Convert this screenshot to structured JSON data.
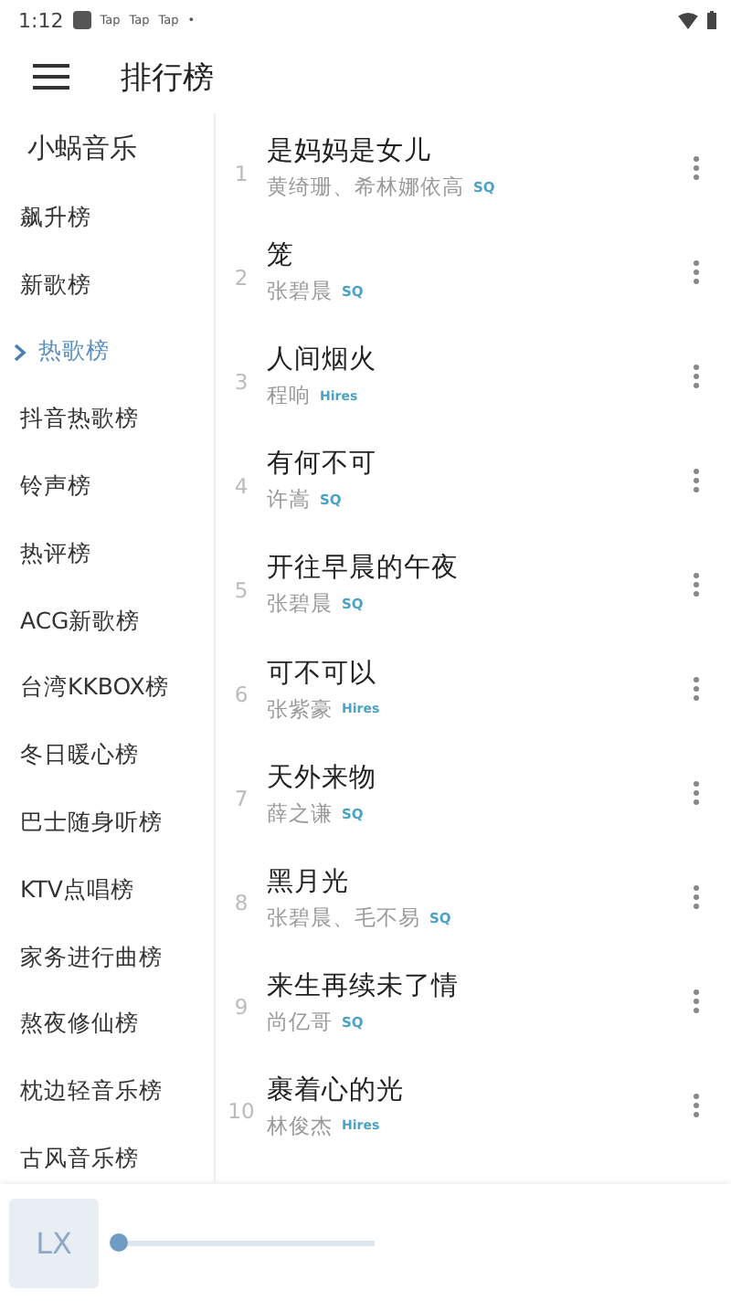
{
  "status_bar": {
    "time": "1:12",
    "notifications": [
      "Tap",
      "Tap",
      "Tap"
    ],
    "more": "•"
  },
  "header": {
    "title": "排行榜"
  },
  "sidebar": {
    "brand": "小蜗音乐",
    "items": [
      {
        "label": "飙升榜",
        "selected": false
      },
      {
        "label": "新歌榜",
        "selected": false
      },
      {
        "label": "热歌榜",
        "selected": true
      },
      {
        "label": "抖音热歌榜",
        "selected": false
      },
      {
        "label": "铃声榜",
        "selected": false
      },
      {
        "label": "热评榜",
        "selected": false
      },
      {
        "label": "ACG新歌榜",
        "selected": false
      },
      {
        "label": "台湾KKBOX榜",
        "selected": false
      },
      {
        "label": "冬日暖心榜",
        "selected": false
      },
      {
        "label": "巴士随身听榜",
        "selected": false
      },
      {
        "label": "KTV点唱榜",
        "selected": false
      },
      {
        "label": "家务进行曲榜",
        "selected": false
      },
      {
        "label": "熬夜修仙榜",
        "selected": false
      },
      {
        "label": "枕边轻音乐榜",
        "selected": false
      },
      {
        "label": "古风音乐榜",
        "selected": false
      }
    ]
  },
  "songs": [
    {
      "rank": "1",
      "title": "是妈妈是女儿",
      "artist": "黄绮珊、希林娜依高",
      "quality": "SQ"
    },
    {
      "rank": "2",
      "title": "笼",
      "artist": "张碧晨",
      "quality": "SQ"
    },
    {
      "rank": "3",
      "title": "人间烟火",
      "artist": "程响",
      "quality": "Hires"
    },
    {
      "rank": "4",
      "title": "有何不可",
      "artist": "许嵩",
      "quality": "SQ"
    },
    {
      "rank": "5",
      "title": "开往早晨的午夜",
      "artist": "张碧晨",
      "quality": "SQ"
    },
    {
      "rank": "6",
      "title": "可不可以",
      "artist": "张紫豪",
      "quality": "Hires"
    },
    {
      "rank": "7",
      "title": "天外来物",
      "artist": "薛之谦",
      "quality": "SQ"
    },
    {
      "rank": "8",
      "title": "黑月光",
      "artist": "张碧晨、毛不易",
      "quality": "SQ"
    },
    {
      "rank": "9",
      "title": "来生再续未了情",
      "artist": "尚亿哥",
      "quality": "SQ"
    },
    {
      "rank": "10",
      "title": "裹着心的光",
      "artist": "林俊杰",
      "quality": "Hires"
    }
  ],
  "player": {
    "cover": "LX",
    "progress": {
      "level": 0
    }
  }
}
